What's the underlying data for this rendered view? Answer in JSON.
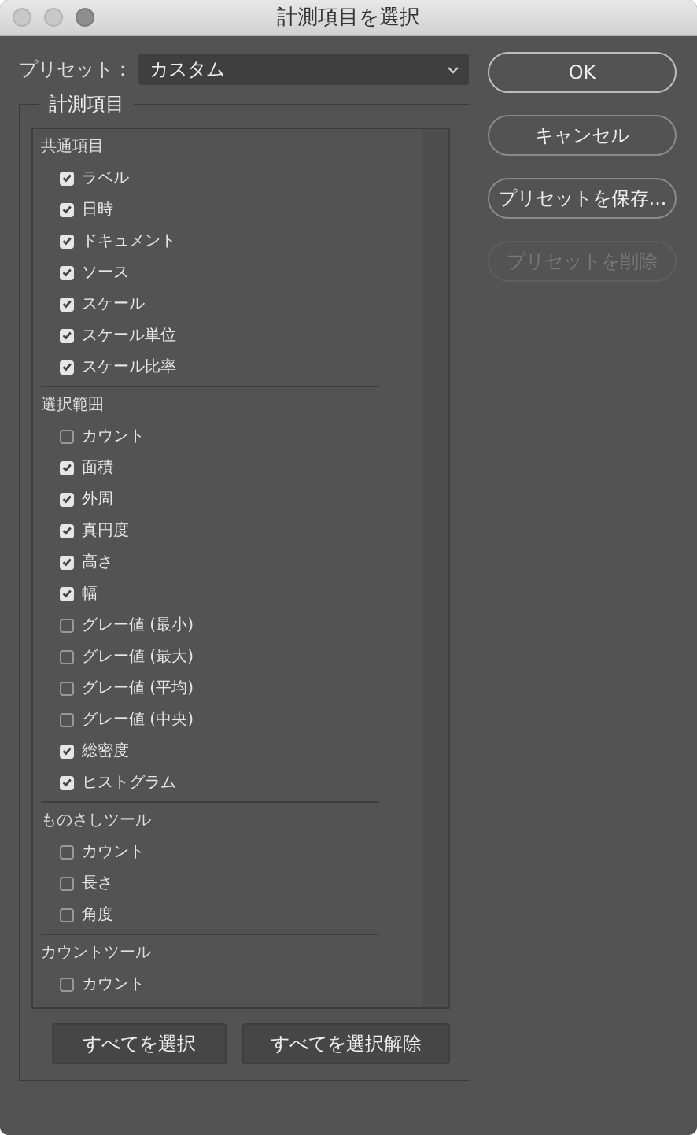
{
  "window": {
    "title": "計測項目を選択"
  },
  "preset": {
    "label": "プリセット：",
    "value": "カスタム"
  },
  "measurements": {
    "title": "計測項目",
    "groups": [
      {
        "title": "共通項目",
        "items": [
          {
            "label": "ラベル",
            "checked": true
          },
          {
            "label": "日時",
            "checked": true
          },
          {
            "label": "ドキュメント",
            "checked": true
          },
          {
            "label": "ソース",
            "checked": true
          },
          {
            "label": "スケール",
            "checked": true
          },
          {
            "label": "スケール単位",
            "checked": true
          },
          {
            "label": "スケール比率",
            "checked": true
          }
        ]
      },
      {
        "title": "選択範囲",
        "items": [
          {
            "label": "カウント",
            "checked": false
          },
          {
            "label": "面積",
            "checked": true
          },
          {
            "label": "外周",
            "checked": true
          },
          {
            "label": "真円度",
            "checked": true
          },
          {
            "label": "高さ",
            "checked": true
          },
          {
            "label": "幅",
            "checked": true
          },
          {
            "label": "グレー値 (最小)",
            "checked": false
          },
          {
            "label": "グレー値 (最大)",
            "checked": false
          },
          {
            "label": "グレー値 (平均)",
            "checked": false
          },
          {
            "label": "グレー値 (中央)",
            "checked": false
          },
          {
            "label": "総密度",
            "checked": true
          },
          {
            "label": "ヒストグラム",
            "checked": true
          }
        ]
      },
      {
        "title": "ものさしツール",
        "items": [
          {
            "label": "カウント",
            "checked": false
          },
          {
            "label": "長さ",
            "checked": false
          },
          {
            "label": "角度",
            "checked": false
          }
        ]
      },
      {
        "title": "カウントツール",
        "items": [
          {
            "label": "カウント",
            "checked": false
          }
        ]
      }
    ],
    "buttons": [
      "すべてを選択",
      "すべてを選択解除"
    ]
  },
  "buttons": [
    {
      "label": "OK",
      "disabled": false,
      "default": true
    },
    {
      "label": "キャンセル",
      "disabled": false,
      "default": false
    },
    {
      "label": "プリセットを保存...",
      "disabled": false,
      "default": false
    },
    {
      "label": "プリセットを削除",
      "disabled": true,
      "default": false
    }
  ]
}
